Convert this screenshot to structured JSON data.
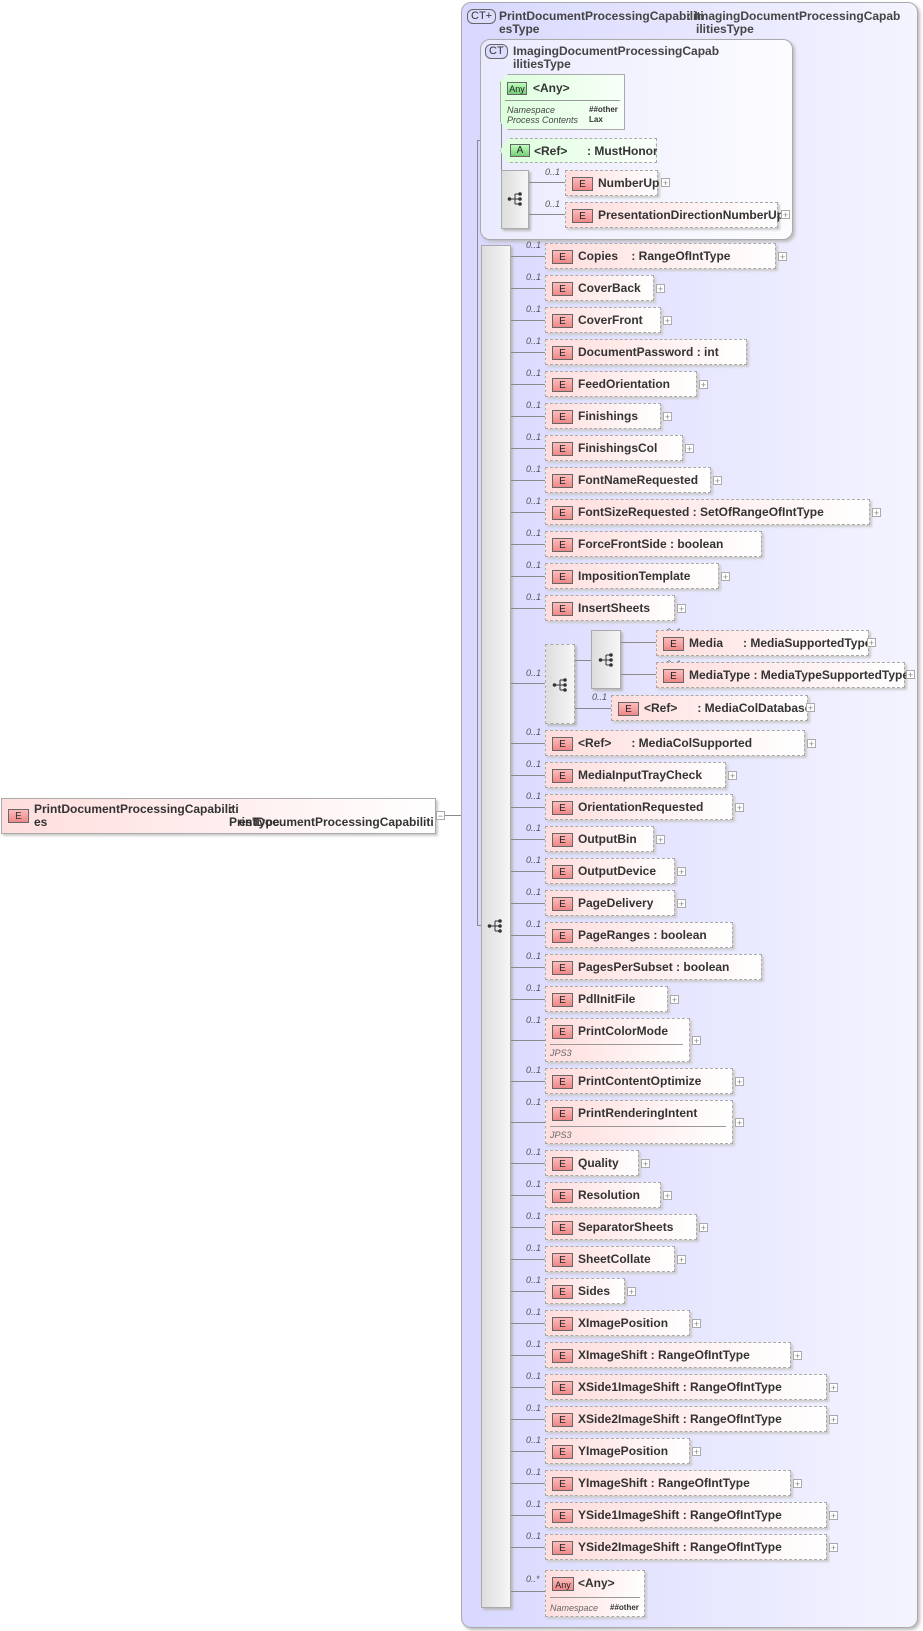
{
  "root_element": {
    "badge": "E",
    "name_line1": "PrintDocumentProcessingCapabiliti",
    "name_line2": "es",
    "type_line1": ": PrintDocumentProcessingCapabiliti",
    "type_line2": "esType",
    "collapse_symbol": "−"
  },
  "outer_type": {
    "badge": "CT+",
    "name_line1": "PrintDocumentProcessingCapabiliti",
    "name_line2": "esType",
    "base_line1": ": ImagingDocumentProcessingCapab",
    "base_line2": "ilitiesType"
  },
  "inner_type": {
    "badge": "CT",
    "name_line1": "ImagingDocumentProcessingCapab",
    "name_line2": "ilitiesType",
    "any": {
      "badge": "Any",
      "label": "<Any>",
      "namespace_label": "Namespace",
      "namespace_value": "##other",
      "process_label": "Process Contents",
      "process_value": "Lax"
    },
    "attribute": {
      "badge": "A",
      "label": "<Ref>",
      "type": ": MustHonor"
    },
    "sequence_items": [
      {
        "occ": "0..1",
        "name": "NumberUp"
      },
      {
        "occ": "0..1",
        "name": "PresentationDirectionNumberUp"
      }
    ]
  },
  "elements": [
    {
      "occ": "0..1",
      "name": "Copies    : RangeOfIntType",
      "plus": true
    },
    {
      "occ": "0..1",
      "name": "CoverBack",
      "plus": true
    },
    {
      "occ": "0..1",
      "name": "CoverFront",
      "plus": true
    },
    {
      "occ": "0..1",
      "name": "DocumentPassword : int",
      "plus": false
    },
    {
      "occ": "0..1",
      "name": "FeedOrientation",
      "plus": true
    },
    {
      "occ": "0..1",
      "name": "Finishings",
      "plus": true
    },
    {
      "occ": "0..1",
      "name": "FinishingsCol",
      "plus": true
    },
    {
      "occ": "0..1",
      "name": "FontNameRequested",
      "plus": true
    },
    {
      "occ": "0..1",
      "name": "FontSizeRequested : SetOfRangeOfIntType",
      "plus": true
    },
    {
      "occ": "0..1",
      "name": "ForceFrontSide : boolean",
      "plus": false
    },
    {
      "occ": "0..1",
      "name": "ImpositionTemplate",
      "plus": true
    },
    {
      "occ": "0..1",
      "name": "InsertSheets",
      "plus": true
    }
  ],
  "media_group": {
    "occ": "0..1",
    "inner": [
      {
        "occ": "0..1",
        "name": "Media      : MediaSupportedType"
      },
      {
        "occ": "0..1",
        "name": "MediaType : MediaTypeSupportedType"
      }
    ],
    "ref": {
      "occ": "0..1",
      "name": "<Ref>      : MediaColDatabase"
    }
  },
  "elements2": [
    {
      "occ": "0..1",
      "name": "<Ref>      : MediaColSupported",
      "plus": true
    },
    {
      "occ": "0..1",
      "name": "MediaInputTrayCheck",
      "plus": true
    },
    {
      "occ": "0..1",
      "name": "OrientationRequested",
      "plus": true
    },
    {
      "occ": "0..1",
      "name": "OutputBin",
      "plus": true
    },
    {
      "occ": "0..1",
      "name": "OutputDevice",
      "plus": true
    },
    {
      "occ": "0..1",
      "name": "PageDelivery",
      "plus": true
    },
    {
      "occ": "0..1",
      "name": "PageRanges : boolean",
      "plus": false
    },
    {
      "occ": "0..1",
      "name": "PagesPerSubset : boolean",
      "plus": false
    },
    {
      "occ": "0..1",
      "name": "PdlInitFile",
      "plus": true
    },
    {
      "occ": "0..1",
      "name": "PrintColorMode",
      "plus": true,
      "note": "JPS3"
    },
    {
      "occ": "0..1",
      "name": "PrintContentOptimize",
      "plus": true
    },
    {
      "occ": "0..1",
      "name": "PrintRenderingIntent",
      "plus": true,
      "note": "JPS3"
    },
    {
      "occ": "0..1",
      "name": "Quality",
      "plus": true
    },
    {
      "occ": "0..1",
      "name": "Resolution",
      "plus": true
    },
    {
      "occ": "0..1",
      "name": "SeparatorSheets",
      "plus": true
    },
    {
      "occ": "0..1",
      "name": "SheetCollate",
      "plus": true
    },
    {
      "occ": "0..1",
      "name": "Sides",
      "plus": true
    },
    {
      "occ": "0..1",
      "name": "XImagePosition",
      "plus": true
    },
    {
      "occ": "0..1",
      "name": "XImageShift : RangeOfIntType",
      "plus": true
    },
    {
      "occ": "0..1",
      "name": "XSide1ImageShift : RangeOfIntType",
      "plus": true
    },
    {
      "occ": "0..1",
      "name": "XSide2ImageShift : RangeOfIntType",
      "plus": true
    },
    {
      "occ": "0..1",
      "name": "YImagePosition",
      "plus": true
    },
    {
      "occ": "0..1",
      "name": "YImageShift : RangeOfIntType",
      "plus": true
    },
    {
      "occ": "0..1",
      "name": "YSide1ImageShift : RangeOfIntType",
      "plus": true
    },
    {
      "occ": "0..1",
      "name": "YSide2ImageShift : RangeOfIntType",
      "plus": true
    }
  ],
  "trailing_any": {
    "occ": "0..*",
    "badge": "Any",
    "label": "<Any>",
    "namespace_label": "Namespace",
    "namespace_value": "##other"
  },
  "plus_symbol": "+"
}
